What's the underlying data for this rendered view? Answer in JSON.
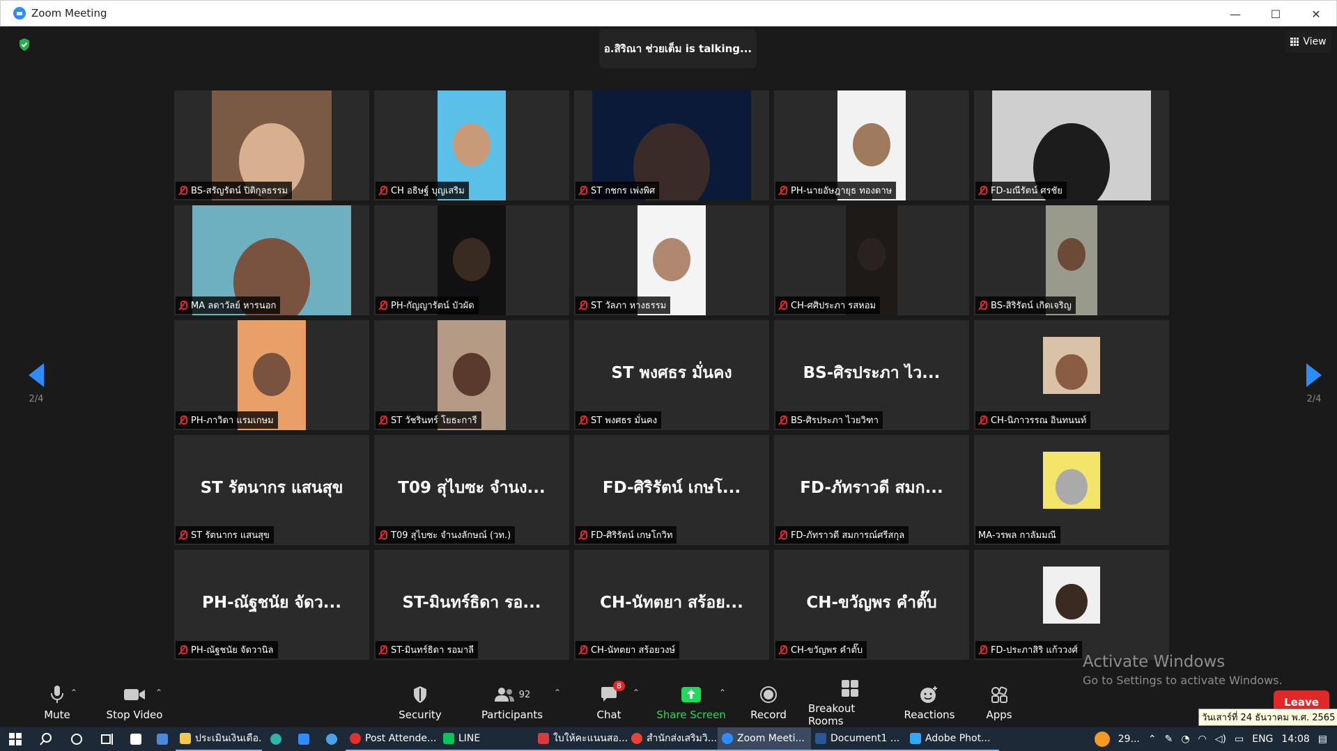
{
  "window": {
    "title": "Zoom Meeting",
    "minimize": "—",
    "maximize": "☐",
    "close": "✕"
  },
  "meeting": {
    "talking": "อ.สิริณา ช่วยเต็ม is  talking...",
    "view_label": "View",
    "page_left": "2/4",
    "page_right": "2/4"
  },
  "tiles": [
    {
      "label": "BS-สรัญรัตน์ ปิติกุลธรรม",
      "video": true,
      "muted": true
    },
    {
      "label": "CH อธิษฐ์ บุญเสริม",
      "video": true,
      "muted": true
    },
    {
      "label": "ST กชกร เพ่งพิศ",
      "video": true,
      "muted": true
    },
    {
      "label": "PH-นายอัษฎายุธ ทองดาษ",
      "video": true,
      "muted": true
    },
    {
      "label": "FD-มณีรัตน์ ศรชัย",
      "video": true,
      "muted": true
    },
    {
      "label": "MA ลดาวัลย์ หารนอก",
      "video": true,
      "muted": true
    },
    {
      "label": "PH-กัญญารัตน์ บัวผัด",
      "video": true,
      "muted": true
    },
    {
      "label": "ST วัลภา หางธรรม",
      "video": true,
      "muted": true
    },
    {
      "label": "CH-ศศิประภา รสหอม",
      "video": true,
      "muted": true
    },
    {
      "label": "BS-สิริรัตน์ เกิดเจริญ",
      "video": true,
      "muted": true
    },
    {
      "label": "PH-ภาวิดา แรมเกษม",
      "video": true,
      "muted": true
    },
    {
      "label": "ST วัชรินทร์ โยธะการี",
      "video": true,
      "muted": true
    },
    {
      "label": "ST พงศธร มั่นคง",
      "bigname": "ST พงศธร มั่นคง",
      "muted": true
    },
    {
      "label": "BS-ศิรประภา ไวยวิฑา",
      "bigname": "BS-ศิรประภา ไว...",
      "muted": true
    },
    {
      "label": "CH-นิภาวรรณ อินทนนท์",
      "video": true,
      "muted": true
    },
    {
      "label": "ST รัตนากร แสนสุข",
      "bigname": "ST รัตนากร แสนสุข",
      "muted": true
    },
    {
      "label": "T09 สุไบซะ จำนงลักษณ์ (วท.)",
      "bigname": "T09 สุไบซะ จำนง...",
      "muted": true
    },
    {
      "label": "FD-ศิริรัตน์ เกษโกวิท",
      "bigname": "FD-ศิริรัตน์ เกษโ...",
      "muted": true
    },
    {
      "label": "FD-ภัทราวดี สมการณ์ศรีสกุล",
      "bigname": "FD-ภัทราวดี สมก...",
      "muted": true
    },
    {
      "label": "MA-วรพล กาลัมมณี",
      "video": true,
      "muted": false
    },
    {
      "label": "PH-ณัฐชนัย จัดวานิล",
      "bigname": "PH-ณัฐชนัย จัดว...",
      "muted": true
    },
    {
      "label": "ST-มินทร์ธิดา รอมาลี",
      "bigname": "ST-มินทร์ธิดา รอ...",
      "muted": true
    },
    {
      "label": "CH-นัทตยา สร้อยวงษ์",
      "bigname": "CH-นัทตยา สร้อย...",
      "muted": true
    },
    {
      "label": "CH-ขวัญพร คำตั๊บ",
      "bigname": "CH-ขวัญพร คำตั๊บ",
      "muted": true
    },
    {
      "label": "FD-ประภาสิริ แก้ววงศ์",
      "video": true,
      "muted": true
    }
  ],
  "toolbar": {
    "mute": "Mute",
    "stop_video": "Stop Video",
    "security": "Security",
    "participants": "Participants",
    "participants_count": "92",
    "chat": "Chat",
    "chat_badge": "8",
    "share_screen": "Share Screen",
    "record": "Record",
    "breakout_rooms": "Breakout Rooms",
    "reactions": "Reactions",
    "apps": "Apps",
    "leave": "Leave"
  },
  "watermark": {
    "line1": "Activate Windows",
    "line2": "Go to Settings to activate Windows."
  },
  "date_tooltip": "วันเสาร์ที่ 24 ธันวาคม พ.ศ. 2565",
  "taskbar": {
    "items": [
      "ประเมินเงินเดือ...",
      "Post Attende...",
      "LINE",
      "ใบให้คะแนนสอ...",
      "สำนักส่งเสริมวิ...",
      "Zoom Meeti...",
      "Document1 ...",
      "Adobe Phot..."
    ],
    "temp": "29...",
    "lang": "ENG",
    "time": "14:08"
  },
  "colors": {
    "accent": "#2d8cff",
    "leave": "#e02828",
    "share": "#23d959",
    "muted": "#e02828"
  }
}
